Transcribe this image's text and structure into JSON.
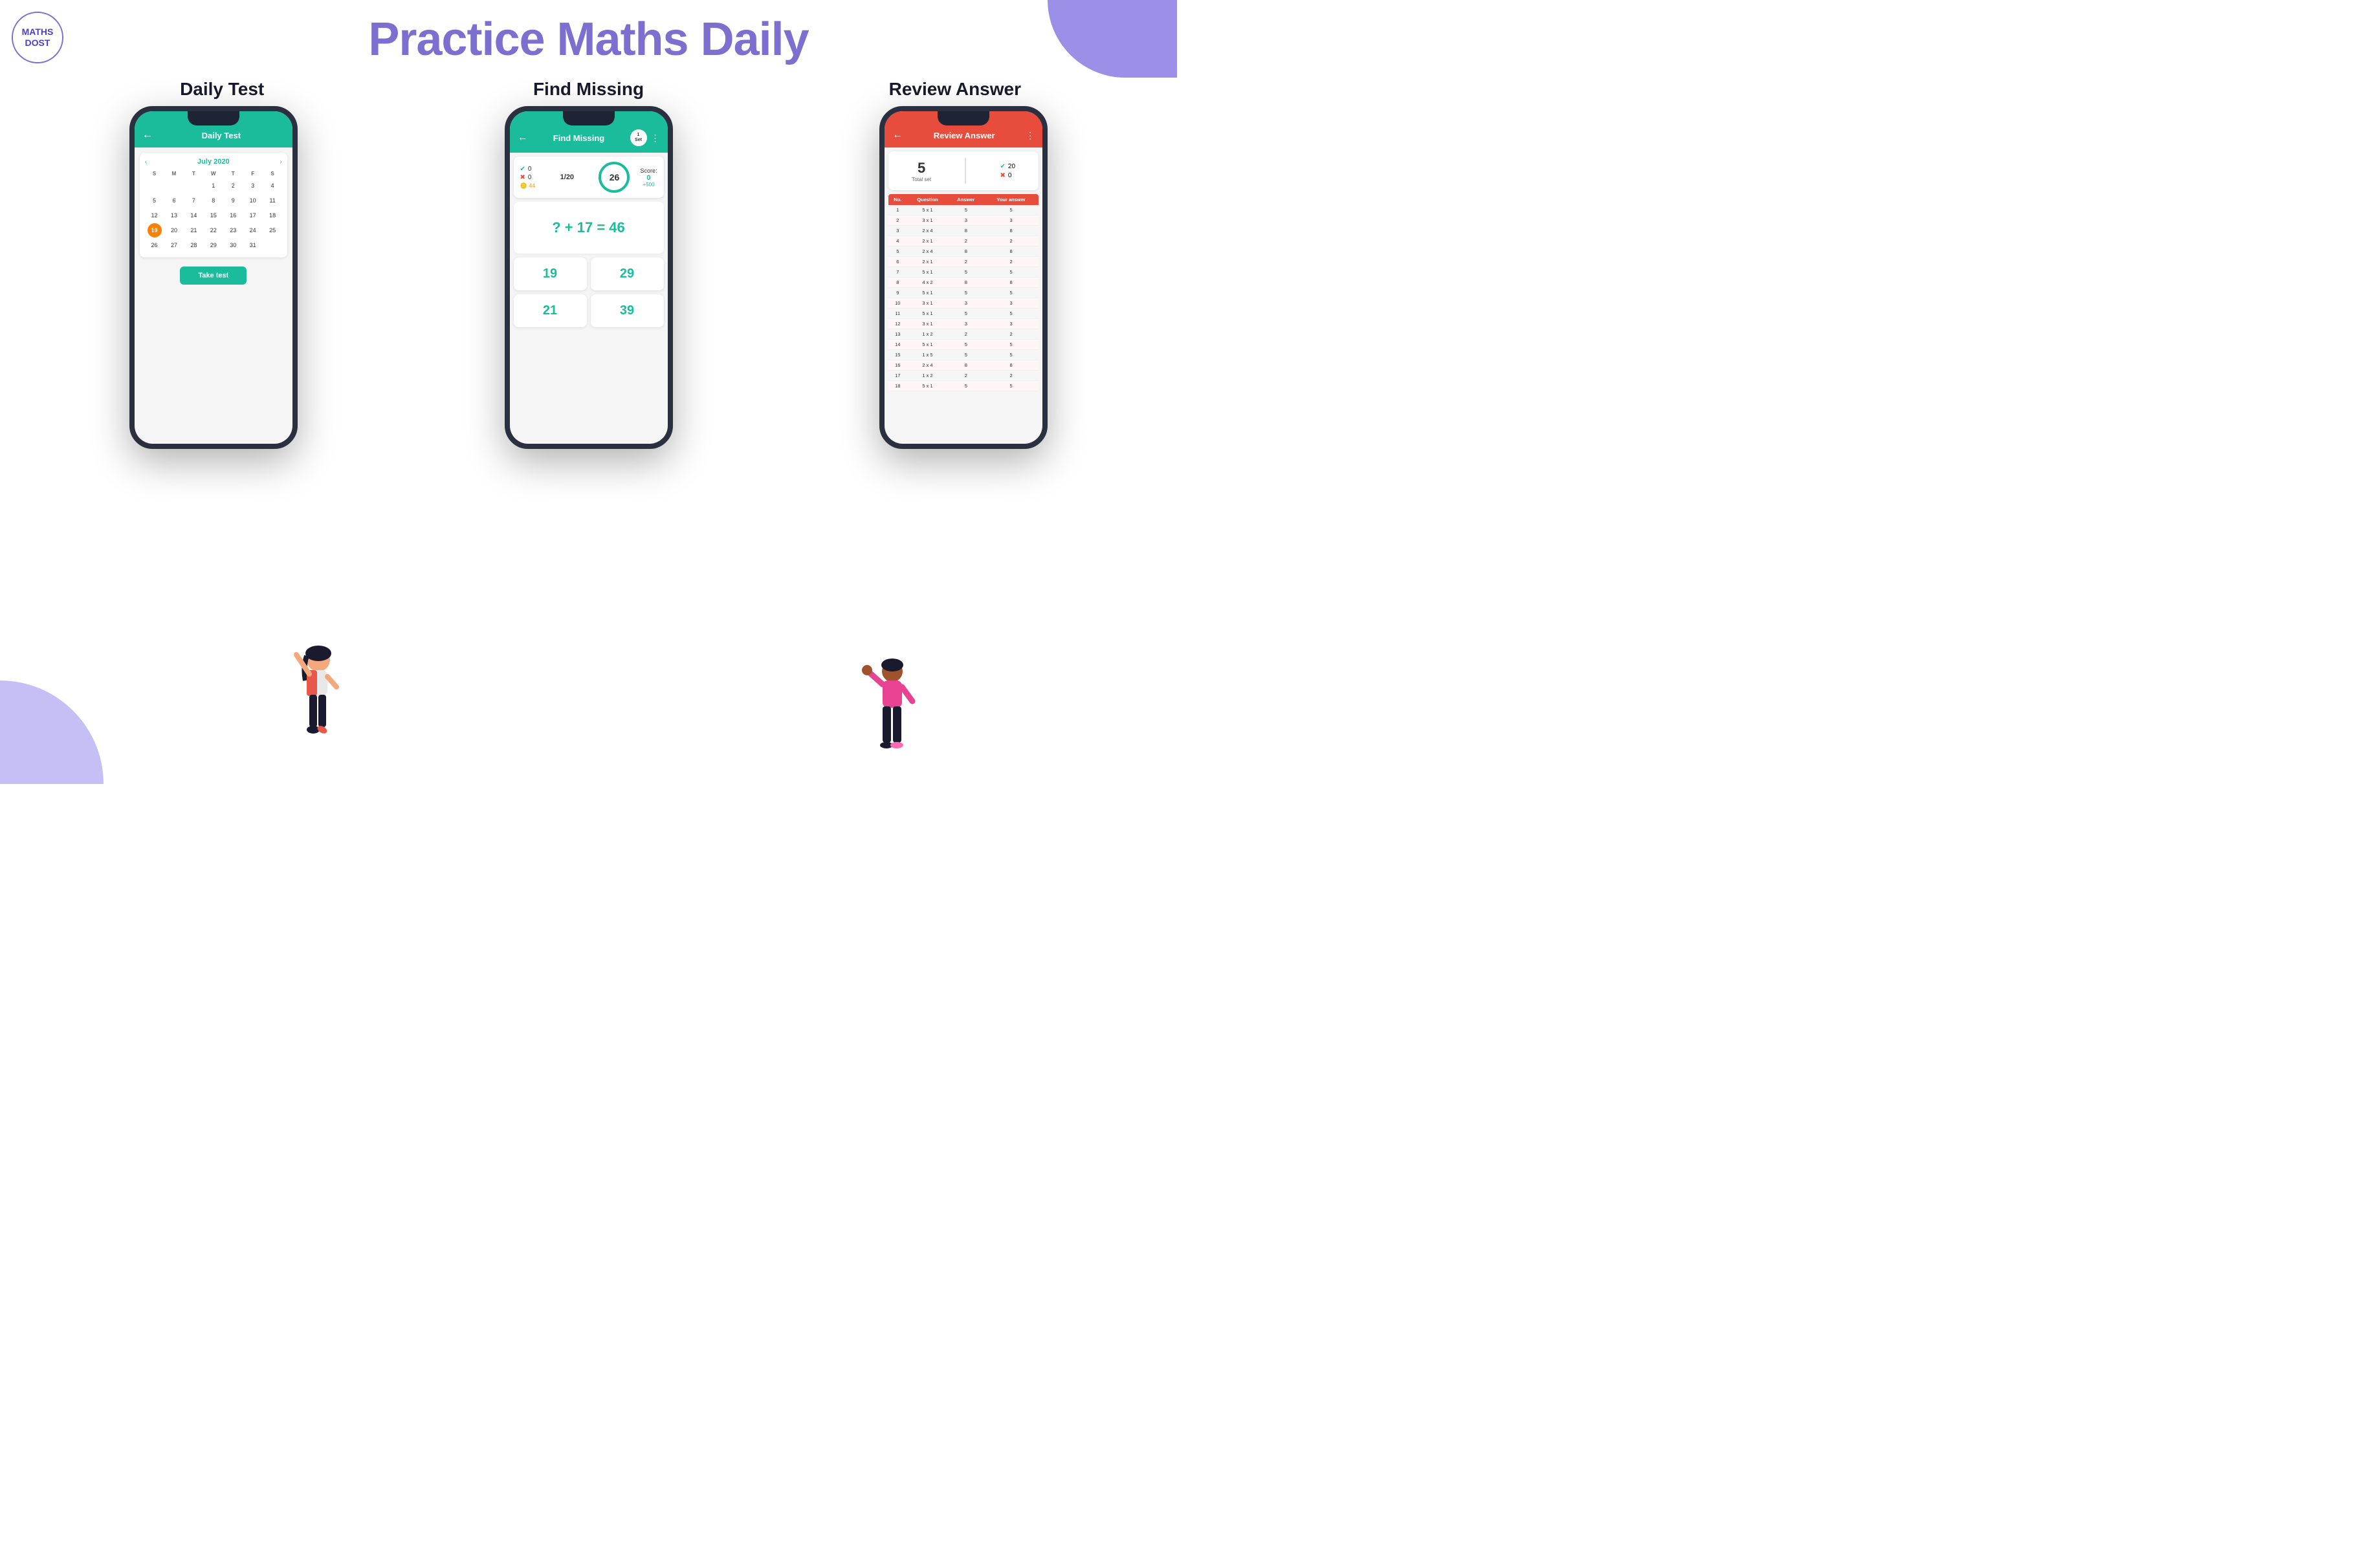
{
  "logo": {
    "text": "MATHS\nDOST"
  },
  "main_title": "Practice Maths Daily",
  "sections": [
    {
      "id": "daily-test",
      "label": "Daily Test"
    },
    {
      "id": "find-missing",
      "label": "Find Missing"
    },
    {
      "id": "review-answer",
      "label": "Review Answer"
    }
  ],
  "phone1": {
    "header": "Daily Test",
    "back": "←",
    "calendar": {
      "month": "July 2020",
      "day_headers": [
        "S",
        "M",
        "T",
        "W",
        "T",
        "F",
        "S"
      ],
      "days": [
        {
          "day": "",
          "today": false
        },
        {
          "day": "",
          "today": false
        },
        {
          "day": "",
          "today": false
        },
        {
          "day": "1",
          "today": false
        },
        {
          "day": "2",
          "today": false
        },
        {
          "day": "3",
          "today": false
        },
        {
          "day": "4",
          "today": false
        },
        {
          "day": "5",
          "today": false
        },
        {
          "day": "6",
          "today": false
        },
        {
          "day": "7",
          "today": false
        },
        {
          "day": "8",
          "today": false
        },
        {
          "day": "9",
          "today": false
        },
        {
          "day": "10",
          "today": false
        },
        {
          "day": "11",
          "today": false
        },
        {
          "day": "12",
          "today": false
        },
        {
          "day": "13",
          "today": false
        },
        {
          "day": "14",
          "today": false
        },
        {
          "day": "15",
          "today": false
        },
        {
          "day": "16",
          "today": false
        },
        {
          "day": "17",
          "today": false
        },
        {
          "day": "18",
          "today": false
        },
        {
          "day": "19",
          "today": true
        },
        {
          "day": "20",
          "today": false
        },
        {
          "day": "21",
          "today": false
        },
        {
          "day": "22",
          "today": false
        },
        {
          "day": "23",
          "today": false
        },
        {
          "day": "24",
          "today": false
        },
        {
          "day": "25",
          "today": false
        },
        {
          "day": "26",
          "today": false
        },
        {
          "day": "27",
          "today": false
        },
        {
          "day": "28",
          "today": false
        },
        {
          "day": "29",
          "today": false
        },
        {
          "day": "30",
          "today": false
        },
        {
          "day": "31",
          "today": false
        },
        {
          "day": "",
          "today": false
        }
      ]
    },
    "take_test_label": "Take test"
  },
  "phone2": {
    "header": "Find Missing",
    "back": "←",
    "set_badge": "1\nSet",
    "correct_count": "0",
    "wrong_count": "0",
    "coins": "44",
    "progress": "26",
    "fraction": "1/20",
    "score_label": "Score:",
    "score_value": "0",
    "score_plus": "+500",
    "question": "? + 17 = 46",
    "answers": [
      "19",
      "29",
      "21",
      "39"
    ]
  },
  "phone3": {
    "header": "Review Answer",
    "back": "←",
    "total_set": "5",
    "total_label": "Total set",
    "correct_count": "20",
    "wrong_count": "0",
    "table_headers": [
      "No.",
      "Question",
      "Answer",
      "Your answer"
    ],
    "table_rows": [
      {
        "no": "1",
        "question": "5 x 1",
        "answer": "5",
        "your_answer": "5"
      },
      {
        "no": "2",
        "question": "3 x 1",
        "answer": "3",
        "your_answer": "3"
      },
      {
        "no": "3",
        "question": "2 x 4",
        "answer": "8",
        "your_answer": "8"
      },
      {
        "no": "4",
        "question": "2 x 1",
        "answer": "2",
        "your_answer": "2"
      },
      {
        "no": "5",
        "question": "2 x 4",
        "answer": "8",
        "your_answer": "8"
      },
      {
        "no": "6",
        "question": "2 x 1",
        "answer": "2",
        "your_answer": "2"
      },
      {
        "no": "7",
        "question": "5 x 1",
        "answer": "5",
        "your_answer": "5"
      },
      {
        "no": "8",
        "question": "4 x 2",
        "answer": "8",
        "your_answer": "8"
      },
      {
        "no": "9",
        "question": "5 x 1",
        "answer": "5",
        "your_answer": "5"
      },
      {
        "no": "10",
        "question": "3 x 1",
        "answer": "3",
        "your_answer": "3"
      },
      {
        "no": "11",
        "question": "5 x 1",
        "answer": "5",
        "your_answer": "5"
      },
      {
        "no": "12",
        "question": "3 x 1",
        "answer": "3",
        "your_answer": "3"
      },
      {
        "no": "13",
        "question": "1 x 2",
        "answer": "2",
        "your_answer": "2"
      },
      {
        "no": "14",
        "question": "5 x 1",
        "answer": "5",
        "your_answer": "5"
      },
      {
        "no": "15",
        "question": "1 x 5",
        "answer": "5",
        "your_answer": "5"
      },
      {
        "no": "16",
        "question": "2 x 4",
        "answer": "8",
        "your_answer": "8"
      },
      {
        "no": "17",
        "question": "1 x 2",
        "answer": "2",
        "your_answer": "2"
      },
      {
        "no": "18",
        "question": "5 x 1",
        "answer": "5",
        "your_answer": "5"
      }
    ]
  },
  "colors": {
    "teal": "#1abc9c",
    "red": "#e74c3c",
    "orange": "#ff7f00",
    "purple": "#7c6fcf",
    "dark": "#1e2433"
  }
}
